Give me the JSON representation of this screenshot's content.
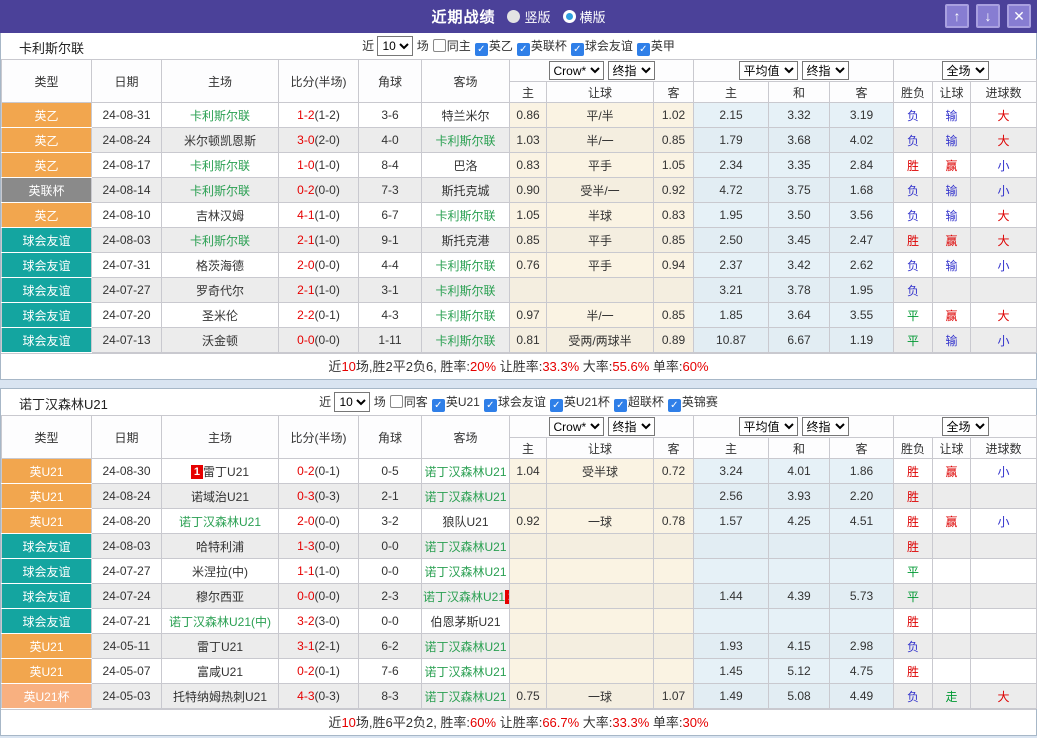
{
  "colors": {
    "top_bar": "#4b4199",
    "page_background": "#d9e4f1",
    "focal_team_green": "#2aa052",
    "fulltime_score_red": "#e60000",
    "odds_column_cream": "#faf3e3",
    "avg_column_blue": "#e6f1f7",
    "alt_row_gray": "#ececec",
    "badge_red": "#e60000"
  },
  "league_colors": {
    "英乙": "#f2a64e",
    "英联杯": "#8a8a8a",
    "球会友谊": "#14a5a0",
    "英U21": "#f2a64e",
    "英U21杯": "#f8b080"
  },
  "result_colors": {
    "胜": "#dd0000",
    "平": "#009933",
    "负": "#3333cc",
    "赢": "#dd0000",
    "输": "#3333cc",
    "走": "#009933",
    "大": "#dd0000",
    "小": "#3333cc"
  },
  "top_bar": {
    "title": "近期战绩",
    "radios": [
      {
        "label": "竖版",
        "selected": true
      },
      {
        "label": "横版",
        "selected": false
      }
    ],
    "buttons": [
      {
        "icon": "up-arrow-icon",
        "glyph": "↑"
      },
      {
        "icon": "down-arrow-icon",
        "glyph": "↓"
      },
      {
        "icon": "close-icon",
        "glyph": "✕"
      }
    ]
  },
  "table_header": {
    "main_cols": [
      "类型",
      "日期",
      "主场",
      "比分(半场)",
      "角球",
      "客场"
    ],
    "odds_selects": [
      "Crow*",
      "终指"
    ],
    "odds_cols": [
      "主",
      "让球",
      "客"
    ],
    "avg_selects": [
      "平均值",
      "终指"
    ],
    "avg_cols": [
      "主",
      "和",
      "客"
    ],
    "scope_select": "全场",
    "scope_cols": [
      "胜负",
      "让球",
      "进球数"
    ]
  },
  "tables": [
    {
      "team": "卡利斯尔联",
      "filters": {
        "prefix": "近",
        "count": "10",
        "suffix": "场",
        "same_venue": {
          "label": "同主",
          "checked": false
        },
        "leagues": [
          {
            "label": "英乙",
            "checked": true
          },
          {
            "label": "英联杯",
            "checked": true
          },
          {
            "label": "球会友谊",
            "checked": true
          },
          {
            "label": "英甲",
            "checked": true
          }
        ]
      },
      "rows": [
        {
          "league": "英乙",
          "date": "24-08-31",
          "home": {
            "name": "卡利斯尔联",
            "focal": true
          },
          "ft": "1-2",
          "ht": "(1-2)",
          "corner": "3-6",
          "away": {
            "name": "特兰米尔",
            "focal": false
          },
          "odds": [
            "0.86",
            "平/半",
            "1.02"
          ],
          "avg": [
            "2.15",
            "3.32",
            "3.19"
          ],
          "results": [
            "负",
            "输",
            "大"
          ]
        },
        {
          "league": "英乙",
          "date": "24-08-24",
          "home": {
            "name": "米尔顿凯恩斯",
            "focal": false
          },
          "ft": "3-0",
          "ht": "(2-0)",
          "corner": "4-0",
          "away": {
            "name": "卡利斯尔联",
            "focal": true
          },
          "odds": [
            "1.03",
            "半/一",
            "0.85"
          ],
          "avg": [
            "1.79",
            "3.68",
            "4.02"
          ],
          "results": [
            "负",
            "输",
            "大"
          ]
        },
        {
          "league": "英乙",
          "date": "24-08-17",
          "home": {
            "name": "卡利斯尔联",
            "focal": true
          },
          "ft": "1-0",
          "ht": "(1-0)",
          "corner": "8-4",
          "away": {
            "name": "巴洛",
            "focal": false
          },
          "odds": [
            "0.83",
            "平手",
            "1.05"
          ],
          "avg": [
            "2.34",
            "3.35",
            "2.84"
          ],
          "results": [
            "胜",
            "赢",
            "小"
          ]
        },
        {
          "league": "英联杯",
          "date": "24-08-14",
          "home": {
            "name": "卡利斯尔联",
            "focal": true
          },
          "ft": "0-2",
          "ht": "(0-0)",
          "corner": "7-3",
          "away": {
            "name": "斯托克城",
            "focal": false
          },
          "odds": [
            "0.90",
            "受半/一",
            "0.92"
          ],
          "avg": [
            "4.72",
            "3.75",
            "1.68"
          ],
          "results": [
            "负",
            "输",
            "小"
          ]
        },
        {
          "league": "英乙",
          "date": "24-08-10",
          "home": {
            "name": "吉林汉姆",
            "focal": false
          },
          "ft": "4-1",
          "ht": "(1-0)",
          "corner": "6-7",
          "away": {
            "name": "卡利斯尔联",
            "focal": true
          },
          "odds": [
            "1.05",
            "半球",
            "0.83"
          ],
          "avg": [
            "1.95",
            "3.50",
            "3.56"
          ],
          "results": [
            "负",
            "输",
            "大"
          ]
        },
        {
          "league": "球会友谊",
          "date": "24-08-03",
          "home": {
            "name": "卡利斯尔联",
            "focal": true
          },
          "ft": "2-1",
          "ht": "(1-0)",
          "corner": "9-1",
          "away": {
            "name": "斯托克港",
            "focal": false
          },
          "odds": [
            "0.85",
            "平手",
            "0.85"
          ],
          "avg": [
            "2.50",
            "3.45",
            "2.47"
          ],
          "results": [
            "胜",
            "赢",
            "大"
          ]
        },
        {
          "league": "球会友谊",
          "date": "24-07-31",
          "home": {
            "name": "格茨海德",
            "focal": false
          },
          "ft": "2-0",
          "ht": "(0-0)",
          "corner": "4-4",
          "away": {
            "name": "卡利斯尔联",
            "focal": true
          },
          "odds": [
            "0.76",
            "平手",
            "0.94"
          ],
          "avg": [
            "2.37",
            "3.42",
            "2.62"
          ],
          "results": [
            "负",
            "输",
            "小"
          ]
        },
        {
          "league": "球会友谊",
          "date": "24-07-27",
          "home": {
            "name": "罗奇代尔",
            "focal": false
          },
          "ft": "2-1",
          "ht": "(1-0)",
          "corner": "3-1",
          "away": {
            "name": "卡利斯尔联",
            "focal": true
          },
          "odds": [
            "",
            "",
            ""
          ],
          "avg": [
            "3.21",
            "3.78",
            "1.95"
          ],
          "results": [
            "负",
            "",
            ""
          ]
        },
        {
          "league": "球会友谊",
          "date": "24-07-20",
          "home": {
            "name": "圣米伦",
            "focal": false
          },
          "ft": "2-2",
          "ht": "(0-1)",
          "corner": "4-3",
          "away": {
            "name": "卡利斯尔联",
            "focal": true
          },
          "odds": [
            "0.97",
            "半/一",
            "0.85"
          ],
          "avg": [
            "1.85",
            "3.64",
            "3.55"
          ],
          "results": [
            "平",
            "赢",
            "大"
          ]
        },
        {
          "league": "球会友谊",
          "date": "24-07-13",
          "home": {
            "name": "沃金顿",
            "focal": false
          },
          "ft": "0-0",
          "ht": "(0-0)",
          "corner": "1-11",
          "away": {
            "name": "卡利斯尔联",
            "focal": true
          },
          "odds": [
            "0.81",
            "受两/两球半",
            "0.89"
          ],
          "avg": [
            "10.87",
            "6.67",
            "1.19"
          ],
          "results": [
            "平",
            "输",
            "小"
          ]
        }
      ],
      "summary_parts": [
        {
          "text": "近",
          "red": false
        },
        {
          "text": "10",
          "red": true
        },
        {
          "text": "场,胜2平2负6, 胜率:",
          "red": false
        },
        {
          "text": "20%",
          "red": true
        },
        {
          "text": " 让胜率:",
          "red": false
        },
        {
          "text": "33.3%",
          "red": true
        },
        {
          "text": " 大率:",
          "red": false
        },
        {
          "text": "55.6%",
          "red": true
        },
        {
          "text": " 单率:",
          "red": false
        },
        {
          "text": "60%",
          "red": true
        }
      ]
    },
    {
      "team": "诺丁汉森林U21",
      "filters": {
        "prefix": "近",
        "count": "10",
        "suffix": "场",
        "same_venue": {
          "label": "同客",
          "checked": false
        },
        "leagues": [
          {
            "label": "英U21",
            "checked": true
          },
          {
            "label": "球会友谊",
            "checked": true
          },
          {
            "label": "英U21杯",
            "checked": true
          },
          {
            "label": "超联杯",
            "checked": true
          },
          {
            "label": "英锦赛",
            "checked": true
          }
        ]
      },
      "rows": [
        {
          "league": "英U21",
          "date": "24-08-30",
          "home": {
            "name": "雷丁U21",
            "focal": false,
            "badge_before": "1"
          },
          "ft": "0-2",
          "ht": "(0-1)",
          "corner": "0-5",
          "away": {
            "name": "诺丁汉森林U21",
            "focal": true
          },
          "odds": [
            "1.04",
            "受半球",
            "0.72"
          ],
          "avg": [
            "3.24",
            "4.01",
            "1.86"
          ],
          "results": [
            "胜",
            "赢",
            "小"
          ]
        },
        {
          "league": "英U21",
          "date": "24-08-24",
          "home": {
            "name": "诺域治U21",
            "focal": false
          },
          "ft": "0-3",
          "ht": "(0-3)",
          "corner": "2-1",
          "away": {
            "name": "诺丁汉森林U21",
            "focal": true
          },
          "odds": [
            "",
            "",
            ""
          ],
          "avg": [
            "2.56",
            "3.93",
            "2.20"
          ],
          "results": [
            "胜",
            "",
            ""
          ]
        },
        {
          "league": "英U21",
          "date": "24-08-20",
          "home": {
            "name": "诺丁汉森林U21",
            "focal": true
          },
          "ft": "2-0",
          "ht": "(0-0)",
          "corner": "3-2",
          "away": {
            "name": "狼队U21",
            "focal": false
          },
          "odds": [
            "0.92",
            "一球",
            "0.78"
          ],
          "avg": [
            "1.57",
            "4.25",
            "4.51"
          ],
          "results": [
            "胜",
            "赢",
            "小"
          ]
        },
        {
          "league": "球会友谊",
          "date": "24-08-03",
          "home": {
            "name": "哈特利浦",
            "focal": false
          },
          "ft": "1-3",
          "ht": "(0-0)",
          "corner": "0-0",
          "away": {
            "name": "诺丁汉森林U21",
            "focal": true
          },
          "odds": [
            "",
            "",
            ""
          ],
          "avg": [
            "",
            "",
            ""
          ],
          "results": [
            "胜",
            "",
            ""
          ]
        },
        {
          "league": "球会友谊",
          "date": "24-07-27",
          "home": {
            "name": "米涅拉(中)",
            "focal": false
          },
          "ft": "1-1",
          "ht": "(1-0)",
          "corner": "0-0",
          "away": {
            "name": "诺丁汉森林U21",
            "focal": true
          },
          "odds": [
            "",
            "",
            ""
          ],
          "avg": [
            "",
            "",
            ""
          ],
          "results": [
            "平",
            "",
            ""
          ]
        },
        {
          "league": "球会友谊",
          "date": "24-07-24",
          "home": {
            "name": "穆尔西亚",
            "focal": false
          },
          "ft": "0-0",
          "ht": "(0-0)",
          "corner": "2-3",
          "away": {
            "name": "诺丁汉森林U21",
            "focal": true,
            "badge_after": "1"
          },
          "odds": [
            "",
            "",
            ""
          ],
          "avg": [
            "1.44",
            "4.39",
            "5.73"
          ],
          "results": [
            "平",
            "",
            ""
          ]
        },
        {
          "league": "球会友谊",
          "date": "24-07-21",
          "home": {
            "name": "诺丁汉森林U21(中)",
            "focal": true
          },
          "ft": "3-2",
          "ht": "(3-0)",
          "corner": "0-0",
          "away": {
            "name": "伯恩茅斯U21",
            "focal": false
          },
          "odds": [
            "",
            "",
            ""
          ],
          "avg": [
            "",
            "",
            ""
          ],
          "results": [
            "胜",
            "",
            ""
          ]
        },
        {
          "league": "英U21",
          "date": "24-05-11",
          "home": {
            "name": "雷丁U21",
            "focal": false
          },
          "ft": "3-1",
          "ht": "(2-1)",
          "corner": "6-2",
          "away": {
            "name": "诺丁汉森林U21",
            "focal": true
          },
          "odds": [
            "",
            "",
            ""
          ],
          "avg": [
            "1.93",
            "4.15",
            "2.98"
          ],
          "results": [
            "负",
            "",
            ""
          ]
        },
        {
          "league": "英U21",
          "date": "24-05-07",
          "home": {
            "name": "富咸U21",
            "focal": false
          },
          "ft": "0-2",
          "ht": "(0-1)",
          "corner": "7-6",
          "away": {
            "name": "诺丁汉森林U21",
            "focal": true
          },
          "odds": [
            "",
            "",
            ""
          ],
          "avg": [
            "1.45",
            "5.12",
            "4.75"
          ],
          "results": [
            "胜",
            "",
            ""
          ]
        },
        {
          "league": "英U21杯",
          "date": "24-05-03",
          "home": {
            "name": "托特纳姆热刺U21",
            "focal": false
          },
          "ft": "4-3",
          "ht": "(0-3)",
          "corner": "8-3",
          "away": {
            "name": "诺丁汉森林U21",
            "focal": true
          },
          "odds": [
            "0.75",
            "一球",
            "1.07"
          ],
          "avg": [
            "1.49",
            "5.08",
            "4.49"
          ],
          "results": [
            "负",
            "走",
            "大"
          ]
        }
      ],
      "summary_parts": [
        {
          "text": "近",
          "red": false
        },
        {
          "text": "10",
          "red": true
        },
        {
          "text": "场,胜6平2负2, 胜率:",
          "red": false
        },
        {
          "text": "60%",
          "red": true
        },
        {
          "text": " 让胜率:",
          "red": false
        },
        {
          "text": "66.7%",
          "red": true
        },
        {
          "text": " 大率:",
          "red": false
        },
        {
          "text": "33.3%",
          "red": true
        },
        {
          "text": " 单率:",
          "red": false
        },
        {
          "text": "30%",
          "red": true
        }
      ]
    }
  ]
}
